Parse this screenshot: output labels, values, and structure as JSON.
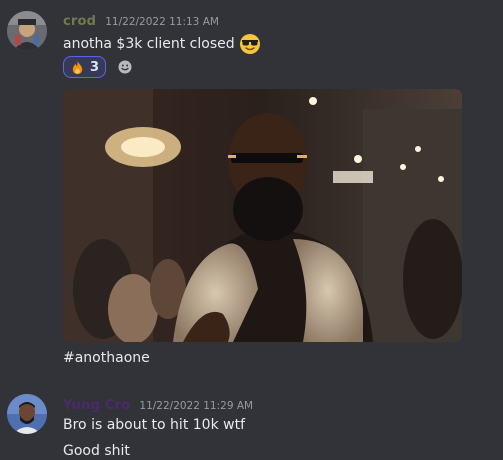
{
  "messages": [
    {
      "username": "crod",
      "timestamp": "11/22/2022 11:13 AM",
      "text": "anotha $3k client closed",
      "reactions": [
        {
          "emoji": "fire-icon",
          "count": "3",
          "selected": true
        }
      ],
      "attachment": {
        "type": "gif"
      },
      "caption": "#anothaone"
    },
    {
      "username": "Yung Cro",
      "timestamp": "11/22/2022 11:29 AM",
      "lines": [
        "Bro is about to hit 10k wtf",
        "Good shit"
      ]
    }
  ],
  "colors": {
    "background": "#313338",
    "reaction_border": "#5865f2",
    "reaction_bg": "#373a54",
    "timestamp": "#949ba4"
  }
}
